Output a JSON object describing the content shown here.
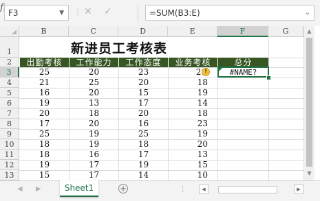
{
  "formula_bar": {
    "name_box": "F3",
    "formula": "=SUM(B3:E)",
    "separator_glyph": "⋮",
    "cancel_glyph": "✕",
    "enter_glyph": "✓",
    "fx_label": "fx",
    "dropdown_glyph": "▼",
    "expand_glyph": "⌄"
  },
  "columns": [
    "B",
    "C",
    "D",
    "E",
    "F",
    "G"
  ],
  "selected_column": "F",
  "row_numbers": [
    "1",
    "2",
    "3",
    "4",
    "5",
    "6",
    "7",
    "8",
    "9",
    "10",
    "11",
    "12",
    "13"
  ],
  "selected_row": "3",
  "sheet": {
    "title": "新进员工考核表",
    "headers": [
      "出勤考核",
      "工作能力",
      "工作态度",
      "业务考核",
      "总分"
    ],
    "rows": [
      [
        "25",
        "20",
        "23",
        "21"
      ],
      [
        "21",
        "25",
        "20",
        "18"
      ],
      [
        "16",
        "20",
        "15",
        "19"
      ],
      [
        "19",
        "13",
        "17",
        "14"
      ],
      [
        "20",
        "18",
        "20",
        "18"
      ],
      [
        "17",
        "20",
        "16",
        "23"
      ],
      [
        "25",
        "19",
        "25",
        "19"
      ],
      [
        "18",
        "19",
        "18",
        "20"
      ],
      [
        "18",
        "16",
        "17",
        "13"
      ],
      [
        "19",
        "17",
        "19",
        "15"
      ],
      [
        "15",
        "17",
        "14",
        "10"
      ]
    ],
    "active_cell_value": "#NAME?",
    "warning_glyph": "!"
  },
  "colors": {
    "header_fill": "#375623",
    "accent": "#217346",
    "warning": "#f3c244"
  },
  "tabs": {
    "prev_glyph": "◀",
    "next_glyph": "▶",
    "sheet_name": "Sheet1",
    "add_glyph": "+",
    "dots_glyph": "⋮"
  },
  "scrollbars": {
    "up_glyph": "▲",
    "down_glyph": "▼",
    "left_glyph": "◀",
    "right_glyph": "▶"
  }
}
